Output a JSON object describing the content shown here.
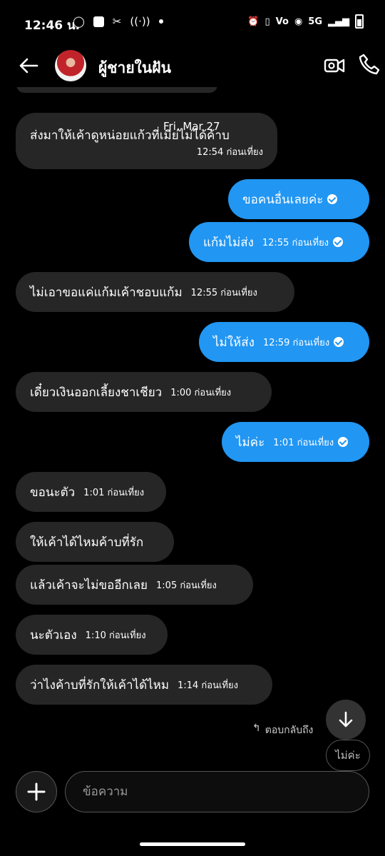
{
  "status": {
    "time": "12:46 น.",
    "network": "5G",
    "icons": [
      "chat-bubble-icon",
      "square-icon",
      "capcut-icon",
      "nfc-icon",
      "dot-icon",
      "alarm-icon",
      "vibrate-icon",
      "volte-icon",
      "wifi-call-icon",
      "signal-icon",
      "battery-icon"
    ]
  },
  "header": {
    "name": "ผู้ชายในฝัน"
  },
  "chat": {
    "date_separator": "Fri, Mar 27",
    "messages": [
      {
        "dir": "in",
        "text": "ส่งมาให้เค้าดูหน่อยแก้วที่เมียไม่ได้ค้าบ",
        "time": "12:54 ก่อนเที่ยง"
      },
      {
        "dir": "out",
        "text": "ขอคนอื่นเลยค่ะ",
        "time": ""
      },
      {
        "dir": "out",
        "text": "แก้มไม่ส่ง",
        "time": "12:55 ก่อนเที่ยง"
      },
      {
        "dir": "in",
        "text": "ไม่เอาขอแค่แก้มเค้าชอบแก้ม",
        "time": "12:55 ก่อนเที่ยง"
      },
      {
        "dir": "out",
        "text": "ไม่ให้ส่ง",
        "time": "12:59 ก่อนเที่ยง"
      },
      {
        "dir": "in",
        "text": "เดี๋ยวเงินออกเลี้ยงชาเชียว",
        "time": "1:00 ก่อนเที่ยง"
      },
      {
        "dir": "out",
        "text": "ไม่ค่ะ",
        "time": "1:01 ก่อนเที่ยง"
      },
      {
        "dir": "in",
        "text": "ขอนะตัว",
        "time": "1:01 ก่อนเที่ยง"
      },
      {
        "dir": "in",
        "text": "ให้เค้าได้ไหมค้าบที่รัก",
        "time": ""
      },
      {
        "dir": "in",
        "text": "แล้วเค้าจะไม่ขออีกเลย",
        "time": "1:05 ก่อนเที่ยง"
      },
      {
        "dir": "in",
        "text": "นะตัวเอง",
        "time": "1:10 ก่อนเที่ยง"
      },
      {
        "dir": "in",
        "text": "ว่าไงค้าบที่รักให้เค้าได้ไหม",
        "time": "1:14 ก่อนเที่ยง"
      }
    ],
    "reply_label": "ตอบกลับถึง",
    "reply_quote": "ไม่ค่ะ"
  },
  "composer": {
    "placeholder": "ข้อความ"
  },
  "colors": {
    "background": "#000000",
    "incoming": "#262626",
    "outgoing": "#2196f3"
  }
}
